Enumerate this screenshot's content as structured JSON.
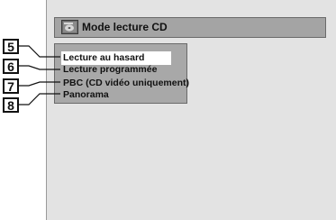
{
  "title_bar": {
    "icon": "disc-icon",
    "title": "Mode lecture CD"
  },
  "menu": {
    "items": [
      {
        "label": "Lecture au hasard",
        "selected": true
      },
      {
        "label": "Lecture programmée",
        "selected": false
      },
      {
        "label": "PBC (CD vidéo uniquement)",
        "selected": false
      },
      {
        "label": "Panorama",
        "selected": false
      }
    ]
  },
  "callouts": [
    "5",
    "6",
    "7",
    "8"
  ]
}
